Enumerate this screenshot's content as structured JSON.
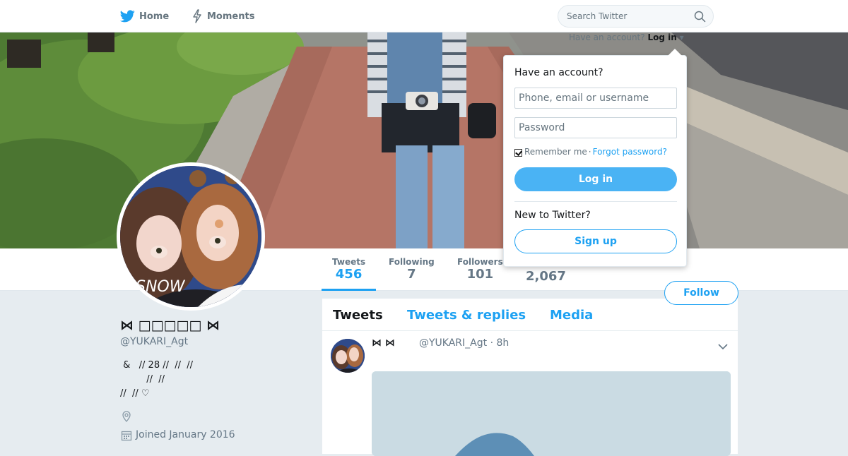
{
  "nav": {
    "home_label": "Home",
    "moments_label": "Moments",
    "search_placeholder": "Search Twitter"
  },
  "account_prompt": {
    "text": "Have an account?",
    "login_link": "Log in"
  },
  "login_dropdown": {
    "heading": "Have an account?",
    "username_placeholder": "Phone, email or username",
    "password_placeholder": "Password",
    "remember_label": "Remember me",
    "separator": "·",
    "forgot_link": "Forgot password?",
    "login_button": "Log in",
    "new_heading": "New to Twitter?",
    "signup_button": "Sign up"
  },
  "stats": [
    {
      "label": "Tweets",
      "value": "456"
    },
    {
      "label": "Following",
      "value": "7"
    },
    {
      "label": "Followers",
      "value": "101"
    },
    {
      "label": "",
      "value": "2,067"
    }
  ],
  "follow_button": "Follow",
  "profile": {
    "name": "⋈ □□□□□ ⋈",
    "handle": "@YUKARI_Agt",
    "bio": " &   // 28 //  //  //\n         //  //\n//  // ♡",
    "joined": "Joined January 2016"
  },
  "timeline": {
    "tabs": [
      "Tweets",
      "Tweets & replies",
      "Media"
    ],
    "tweet": {
      "name": "⋈ ⋈",
      "handle": "@YUKARI_Agt",
      "time": "8h"
    }
  },
  "colors": {
    "accent": "#1da1f2",
    "login_button": "#4ab3f4",
    "background": "#e6ecf0"
  }
}
